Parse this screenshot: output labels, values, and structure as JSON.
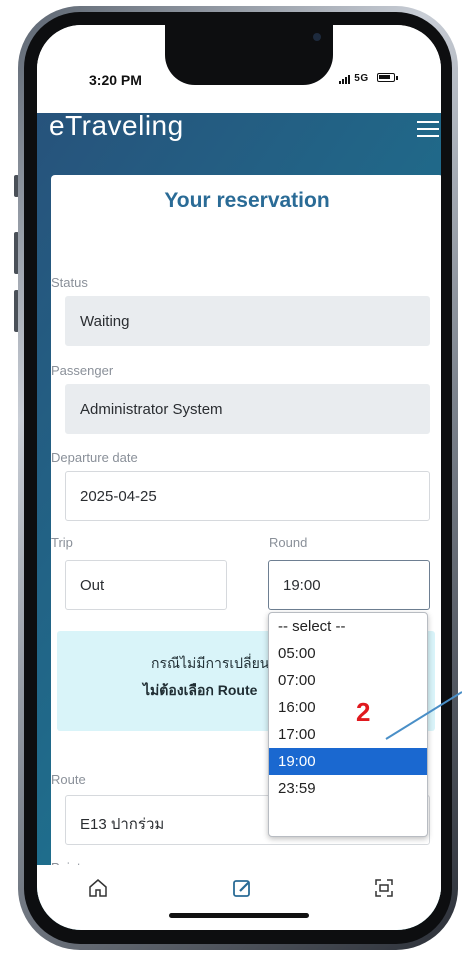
{
  "status_bar": {
    "time": "3:20 PM",
    "network": "5G"
  },
  "app": {
    "brand": "eTraveling"
  },
  "page": {
    "title": "Your reservation",
    "status": {
      "label": "Status",
      "value": "Waiting"
    },
    "passenger": {
      "label": "Passenger",
      "value": "Administrator  System"
    },
    "departure_date": {
      "label": "Departure date",
      "value": "2025-04-25"
    },
    "trip": {
      "label": "Trip",
      "value": "Out"
    },
    "round": {
      "label": "Round",
      "value": "19:00",
      "options": [
        "-- select --",
        "05:00",
        "07:00",
        "16:00",
        "17:00",
        "19:00",
        "23:59"
      ],
      "selected_index": 5
    },
    "info": {
      "line1": "กรณีไม่มีการเปลี่ยน",
      "line2": "ไม่ต้องเลือก Route"
    },
    "route": {
      "label": "Route",
      "value": "E13 ปากร่วม"
    },
    "point": {
      "label": "Point"
    }
  },
  "annotation": {
    "number": "2",
    "color": "#e0191e"
  },
  "colors": {
    "header_start": "#27527b",
    "header_end": "#1a8a95",
    "title": "#2a6b96",
    "selected": "#1a68d0",
    "info_bg": "#d9f4f9"
  },
  "tabbar": {
    "icons": [
      "home-icon",
      "edit-icon",
      "scan-icon"
    ]
  }
}
